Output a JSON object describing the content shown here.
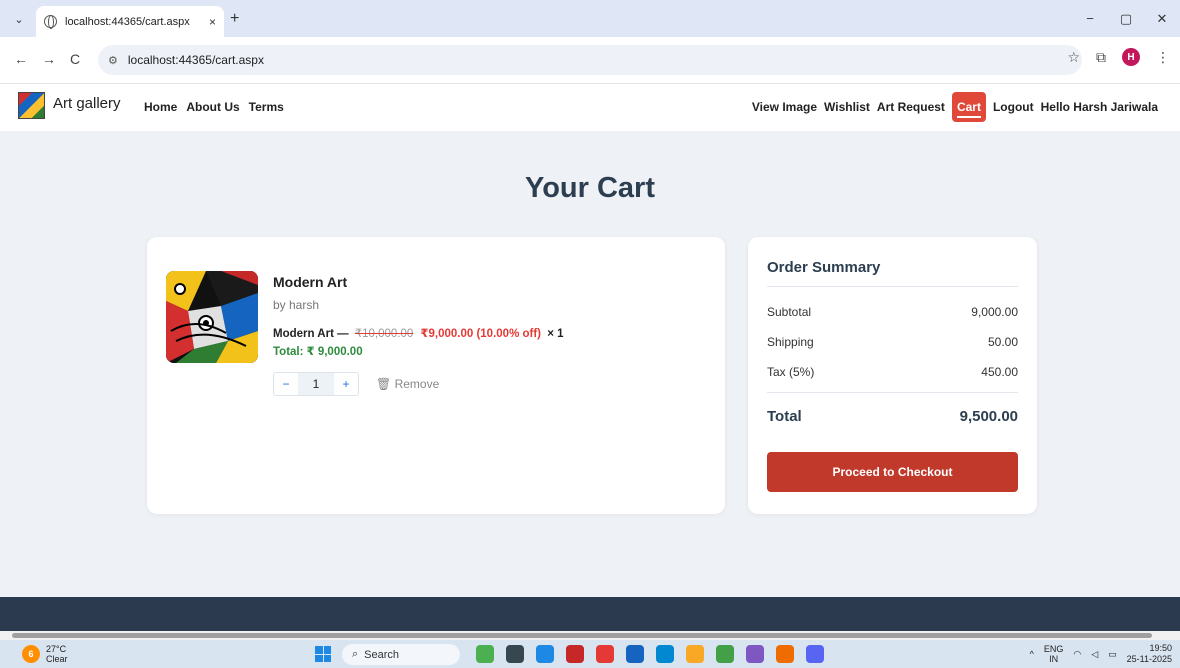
{
  "browser": {
    "tab_title": "localhost:44365/cart.aspx",
    "tab_close": "×",
    "new_tab": "+",
    "url": "localhost:44365/cart.aspx",
    "profile_initial": "H",
    "window": {
      "minimize": "−",
      "restore": "▢",
      "close": "✕"
    },
    "nav": {
      "back": "←",
      "forward": "→",
      "reload": "C"
    }
  },
  "site": {
    "brand": "Art gallery",
    "nav_left": [
      "Home",
      "About Us",
      "Terms"
    ],
    "nav_right": [
      "View Image",
      "Wishlist",
      "Art Request",
      "Cart",
      "Logout",
      "Hello Harsh Jariwala"
    ],
    "active_nav": "Cart"
  },
  "page": {
    "title": "Your Cart"
  },
  "cart_item": {
    "name": "Modern Art",
    "artist": "by harsh",
    "line_name": "Modern Art —",
    "original_price": "₹10,000.00",
    "discounted_price": "₹9,000.00 (10.00% off)",
    "quantity_suffix": "× 1",
    "total": "Total: ₹ 9,000.00",
    "qty_minus": "−",
    "qty_value": "1",
    "qty_plus": "+",
    "remove_label": "🗑 Remove"
  },
  "summary": {
    "title": "Order Summary",
    "rows": [
      {
        "label": "Subtotal",
        "value": "9,000.00"
      },
      {
        "label": "Shipping",
        "value": "50.00"
      },
      {
        "label": "Tax (5%)",
        "value": "450.00"
      }
    ],
    "total_label": "Total",
    "total_value": "9,500.00",
    "checkout_label": "Proceed to Checkout"
  },
  "taskbar": {
    "weather_badge": "6",
    "temperature": "27°C",
    "condition": "Clear",
    "search_placeholder": "Search",
    "lang_top": "ENG",
    "lang_bottom": "IN",
    "time": "19:50",
    "date": "25-11-2025"
  },
  "colors": {
    "accent_red": "#c0392b",
    "active_nav": "#e0483a",
    "discount_red": "#e53935",
    "total_green": "#2e8b3d",
    "footer": "#2c3a4f"
  }
}
